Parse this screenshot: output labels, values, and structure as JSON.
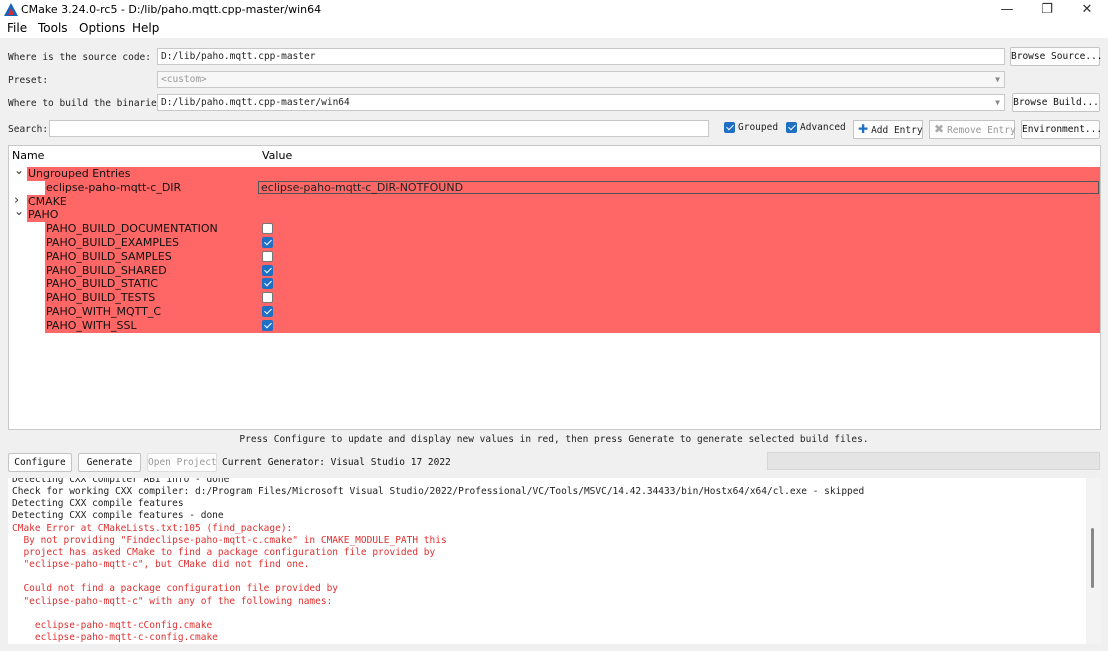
{
  "window": {
    "title": "CMake 3.24.0-rc5 - D:/lib/paho.mqtt.cpp-master/win64",
    "controls": {
      "minimize": "—",
      "maximize": "❐",
      "close": "✕"
    }
  },
  "menu": [
    "File",
    "Tools",
    "Options",
    "Help"
  ],
  "source": {
    "label": "Where is the source code:",
    "value": "D:/lib/paho.mqtt.cpp-master",
    "button": "Browse Source..."
  },
  "preset": {
    "label": "Preset:",
    "value": "<custom>"
  },
  "build": {
    "label": "Where to build the binaries:",
    "value": "D:/lib/paho.mqtt.cpp-master/win64",
    "button": "Browse Build..."
  },
  "search": {
    "label": "Search:",
    "value": ""
  },
  "toolbar": {
    "grouped": {
      "label": "Grouped",
      "checked": true
    },
    "advanced": {
      "label": "Advanced",
      "checked": true
    },
    "add_entry": "Add Entry",
    "remove_entry": "Remove Entry",
    "environment": "Environment..."
  },
  "tree": {
    "header": {
      "name": "Name",
      "value": "Value"
    },
    "rows": [
      {
        "type": "group",
        "expanded": true,
        "name": "Ungrouped Entries"
      },
      {
        "type": "text",
        "name": "eclipse-paho-mqtt-c_DIR",
        "value": "eclipse-paho-mqtt-c_DIR-NOTFOUND"
      },
      {
        "type": "group",
        "expanded": false,
        "name": "CMAKE"
      },
      {
        "type": "group",
        "expanded": true,
        "name": "PAHO"
      },
      {
        "type": "bool",
        "name": "PAHO_BUILD_DOCUMENTATION",
        "checked": false
      },
      {
        "type": "bool",
        "name": "PAHO_BUILD_EXAMPLES",
        "checked": true
      },
      {
        "type": "bool",
        "name": "PAHO_BUILD_SAMPLES",
        "checked": false
      },
      {
        "type": "bool",
        "name": "PAHO_BUILD_SHARED",
        "checked": true
      },
      {
        "type": "bool",
        "name": "PAHO_BUILD_STATIC",
        "checked": true
      },
      {
        "type": "bool",
        "name": "PAHO_BUILD_TESTS",
        "checked": false
      },
      {
        "type": "bool",
        "name": "PAHO_WITH_MQTT_C",
        "checked": true
      },
      {
        "type": "bool",
        "name": "PAHO_WITH_SSL",
        "checked": true
      }
    ]
  },
  "info_text": "Press Configure to update and display new values in red, then press Generate to generate selected build files.",
  "actions": {
    "configure": "Configure",
    "generate": "Generate",
    "open_project": "Open Project",
    "generator": "Current Generator: Visual Studio 17 2022"
  },
  "output": [
    {
      "text": "Detecting CXX compiler ABI info - done",
      "kind": "dark"
    },
    {
      "text": "Check for working CXX compiler: d:/Program Files/Microsoft Visual Studio/2022/Professional/VC/Tools/MSVC/14.42.34433/bin/Hostx64/x64/cl.exe - skipped",
      "kind": "dark"
    },
    {
      "text": "Detecting CXX compile features",
      "kind": "dark"
    },
    {
      "text": "Detecting CXX compile features - done",
      "kind": "dark"
    },
    {
      "text": "CMake Error at CMakeLists.txt:105 (find_package):",
      "kind": "err"
    },
    {
      "text": "  By not providing \"Findeclipse-paho-mqtt-c.cmake\" in CMAKE_MODULE_PATH this",
      "kind": "err"
    },
    {
      "text": "  project has asked CMake to find a package configuration file provided by",
      "kind": "err"
    },
    {
      "text": "  \"eclipse-paho-mqtt-c\", but CMake did not find one.",
      "kind": "err"
    },
    {
      "text": "",
      "kind": "err"
    },
    {
      "text": "  Could not find a package configuration file provided by",
      "kind": "err"
    },
    {
      "text": "  \"eclipse-paho-mqtt-c\" with any of the following names:",
      "kind": "err"
    },
    {
      "text": "",
      "kind": "err"
    },
    {
      "text": "    eclipse-paho-mqtt-cConfig.cmake",
      "kind": "err"
    },
    {
      "text": "    eclipse-paho-mqtt-c-config.cmake",
      "kind": "err"
    }
  ],
  "colors": {
    "changed_row": "#ff6666",
    "error_text": "#e03030",
    "checkbox": "#1f6fc5"
  }
}
